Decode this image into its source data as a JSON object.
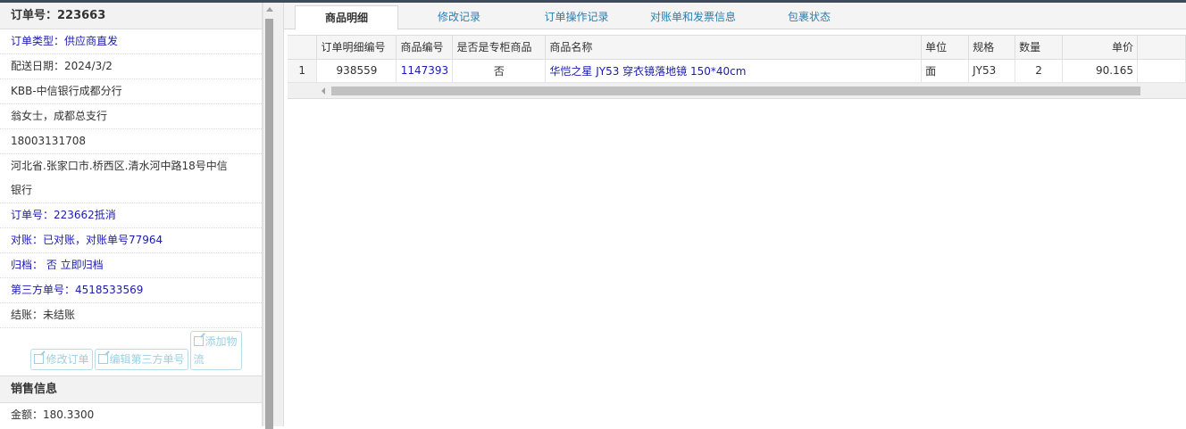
{
  "order": {
    "title": "订单号：223663",
    "fields": [
      {
        "text": "订单类型：供应商直发",
        "blue": true
      },
      {
        "text": "配送日期：2024/3/2",
        "blue": false
      },
      {
        "text": "KBB-中信银行成都分行",
        "blue": false
      },
      {
        "text": "翁女士，成都总支行",
        "blue": false
      },
      {
        "text": "18003131708",
        "blue": false
      },
      {
        "text": "河北省.张家口市.桥西区.清水河中路18号中信",
        "blue": false
      },
      {
        "text": "银行",
        "blue": false
      },
      {
        "text": "订单号：223662抵消",
        "blue": true
      },
      {
        "text": "对账：已对账，对账单号77964",
        "blue": true
      },
      {
        "text": "归档：  否 立即归档",
        "blue": true
      },
      {
        "text": "第三方单号：4518533569",
        "blue": true
      },
      {
        "text": "结账：未结账",
        "blue": false
      }
    ],
    "buttons": {
      "edit_order": "修改订单",
      "edit_third_party": "编辑第三方单号",
      "add_logistics": "添加物流"
    }
  },
  "sales": {
    "title": "销售信息",
    "amount": "金额：180.3300"
  },
  "tabs": [
    "商品明细",
    "修改记录",
    "订单操作记录",
    "对账单和发票信息",
    "包裹状态"
  ],
  "table": {
    "headers": [
      "订单明细编号",
      "商品编号",
      "是否是专柜商品",
      "商品名称",
      "单位",
      "规格",
      "数量",
      "单价"
    ],
    "rows": [
      {
        "index": "1",
        "detail_id": "938559",
        "product_id": "1147393",
        "is_counter": "否",
        "name": "华恺之星 JY53 穿衣镜落地镜 150*40cm",
        "unit": "面",
        "spec": "JY53",
        "qty": "2",
        "price": "90.165"
      }
    ]
  }
}
